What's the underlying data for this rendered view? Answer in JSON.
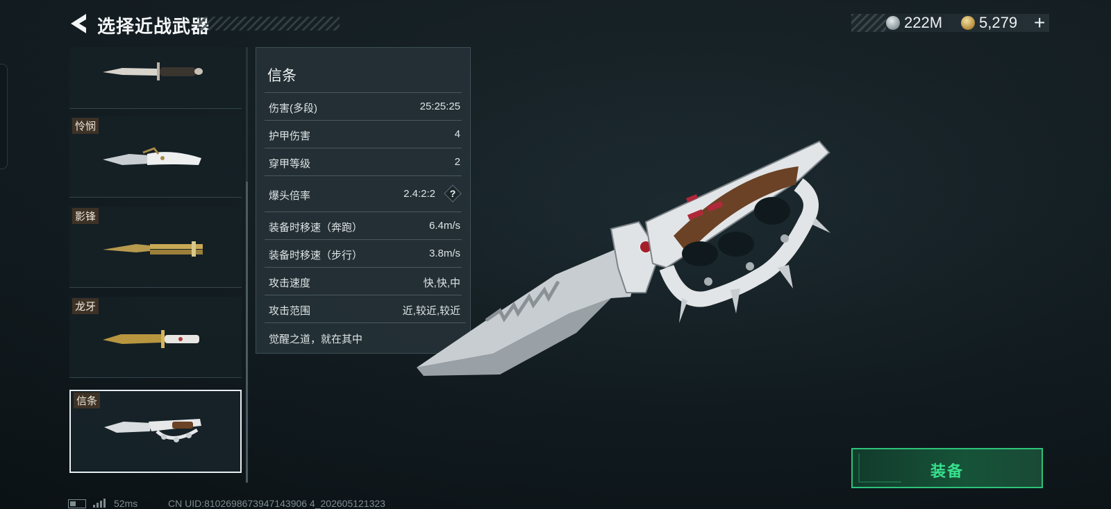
{
  "header": {
    "title": "选择近战武器"
  },
  "currency": {
    "silver": "222M",
    "gold": "5,279",
    "add_label": "+"
  },
  "weapons": [
    {
      "label": "",
      "icon": "bayonet-knife-icon"
    },
    {
      "label": "怜悯",
      "icon": "folding-knife-icon"
    },
    {
      "label": "影锋",
      "icon": "butterfly-knife-icon"
    },
    {
      "label": "龙牙",
      "icon": "gold-combat-knife-icon"
    },
    {
      "label": "信条",
      "icon": "knuckle-knife-icon",
      "selected": true
    }
  ],
  "stats": {
    "title": "信条",
    "rows": [
      {
        "label": "伤害(多段)",
        "value": "25:25:25"
      },
      {
        "label": "护甲伤害",
        "value": "4"
      },
      {
        "label": "穿甲等级",
        "value": "2"
      },
      {
        "label": "爆头倍率",
        "value": "2.4:2:2",
        "help": "?"
      },
      {
        "label": "装备时移速（奔跑）",
        "value": "6.4m/s"
      },
      {
        "label": "装备时移速（步行）",
        "value": "3.8m/s"
      },
      {
        "label": "攻击速度",
        "value": "快,快,中"
      },
      {
        "label": "攻击范围",
        "value": "近,较近,较近"
      }
    ],
    "description": "觉醒之道，就在其中"
  },
  "equip": {
    "label": "装备"
  },
  "status": {
    "ping": "52ms",
    "uid": "CN UID:8102698673947143906 4_202605121323"
  },
  "colors": {
    "accent_green": "#2dc37a",
    "label_bg": "#3e3226",
    "panel_bg": "#243036"
  }
}
